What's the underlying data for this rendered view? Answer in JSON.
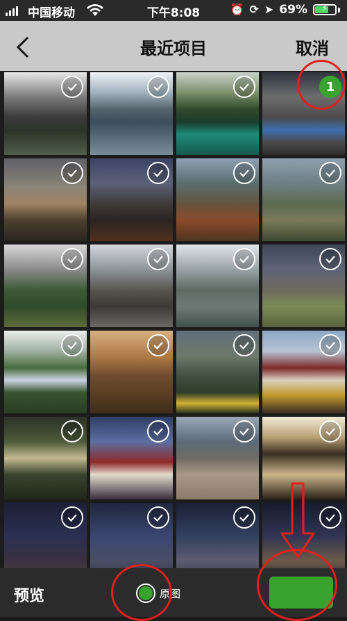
{
  "status_bar": {
    "carrier": "中国移动",
    "time": "下午8:08",
    "battery_percent": "69%",
    "battery_level": 0.69,
    "icons": [
      "signal-icon",
      "wifi-icon",
      "alarm-icon",
      "orientation-lock-icon",
      "location-icon",
      "battery-icon"
    ]
  },
  "nav": {
    "back_icon": "chevron-left-icon",
    "title": "最近项目",
    "cancel": "取消"
  },
  "grid": {
    "tiles": [
      {
        "photo": "clouds-lake-valley",
        "selected": false
      },
      {
        "photo": "mountain-lake",
        "selected": false
      },
      {
        "photo": "forest-turquoise-lake",
        "selected": false
      },
      {
        "photo": "mountain-blue-lakes",
        "selected": true,
        "order": "1"
      },
      {
        "photo": "snowy-peak",
        "selected": false
      },
      {
        "photo": "winding-road-night",
        "selected": false
      },
      {
        "photo": "autumn-valley",
        "selected": false
      },
      {
        "photo": "switchback-road",
        "selected": false
      },
      {
        "photo": "misty-village",
        "selected": false
      },
      {
        "photo": "rocky-riverbed",
        "selected": false
      },
      {
        "photo": "snowy-lake",
        "selected": false
      },
      {
        "photo": "rainbow-grassland",
        "selected": false
      },
      {
        "photo": "valley-lake-clouds",
        "selected": false
      },
      {
        "photo": "sunset-village",
        "selected": false
      },
      {
        "photo": "yellow-flowers",
        "selected": false
      },
      {
        "photo": "potala-palace-dancer",
        "selected": false
      },
      {
        "photo": "sunbeam-forest",
        "selected": false
      },
      {
        "photo": "potala-palace-night",
        "selected": false
      },
      {
        "photo": "beach-stone",
        "selected": false
      },
      {
        "photo": "light-shadow-room",
        "selected": false
      },
      {
        "photo": "milky-way-dish",
        "selected": false
      },
      {
        "photo": "radio-telescope",
        "selected": false
      },
      {
        "photo": "telescope-night",
        "selected": false
      },
      {
        "photo": "dish-milky-way",
        "selected": false
      }
    ]
  },
  "bottom": {
    "preview": "预览",
    "original": "原图",
    "original_checked": true
  },
  "colors": {
    "accent_green": "#3aa32f",
    "annotation_red": "#e2201c"
  }
}
